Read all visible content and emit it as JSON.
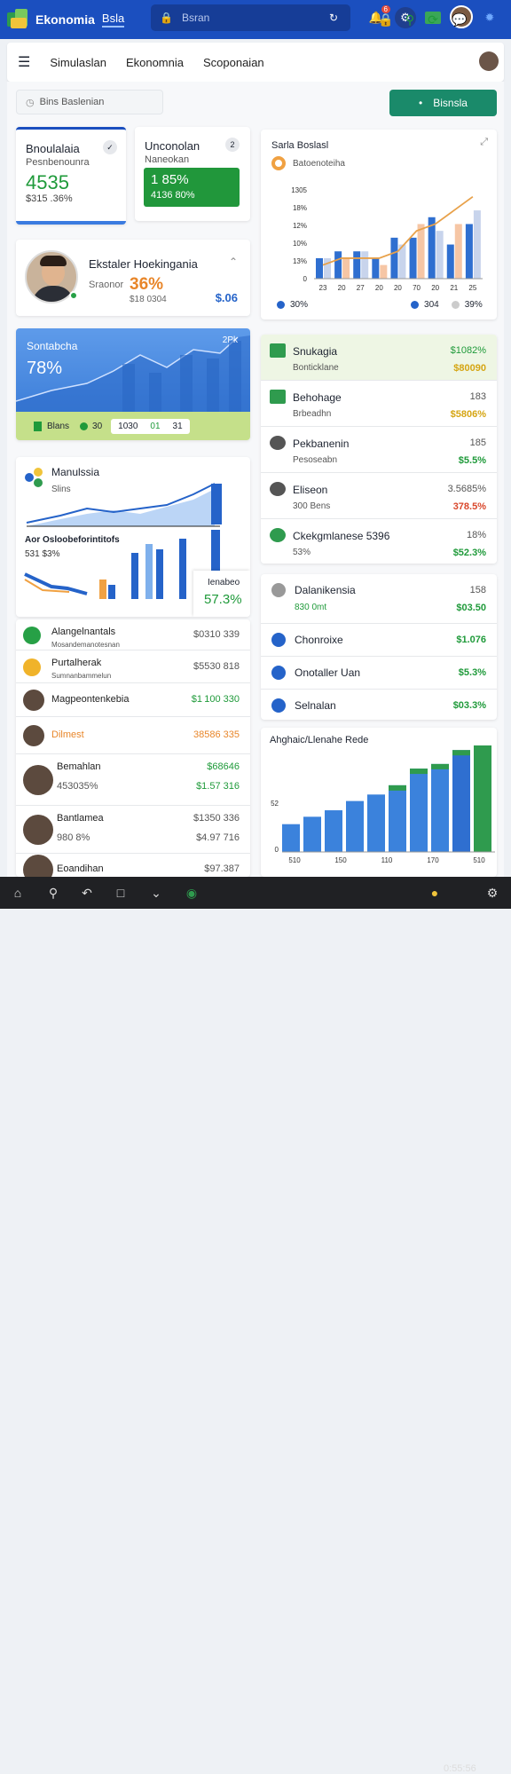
{
  "app": {
    "title": "Ekonomia",
    "tab": "Bsla",
    "search_placeholder": "Bsran",
    "notif_count": "6"
  },
  "nav": {
    "links": [
      "Simulaslan",
      "Ekonomnia",
      "Scoponaian"
    ]
  },
  "toolbar": {
    "filter_placeholder": "Bins Baslenian",
    "cta_label": "Bisnsla"
  },
  "stat1": {
    "title": "Bnoulalaia",
    "subtitle": "Pesnbenounra",
    "value": "4535",
    "sub_value": "$315 .36%"
  },
  "stat2": {
    "title": "Unconolan",
    "subtitle": "Naneokan",
    "value": "1 85%",
    "sub_value": "4136 80%",
    "badge": "2"
  },
  "profile": {
    "title": "Ekstaler Hoekingania",
    "label": "Sraonor",
    "pct": "36%",
    "sub": "$18 0304",
    "value": "$.06"
  },
  "summary": {
    "title": "Sontabcha",
    "value": "78%",
    "legend": [
      "Blans",
      "30",
      "1030",
      "01",
      "31",
      "2Pk"
    ]
  },
  "bar_panel": {
    "title": "Sarla Boslasl",
    "subtitle": "Batoenoteiha",
    "footer": [
      "30%",
      "304",
      "39%"
    ]
  },
  "chart_data": [
    {
      "type": "bar",
      "title": "Sarla Boslasl",
      "y_ticks": [
        "1305",
        "18%",
        "12%",
        "10%",
        "13%",
        "0"
      ],
      "x_ticks": [
        "23",
        "20",
        "27",
        "20",
        "20",
        "70",
        "20",
        "21",
        "25"
      ],
      "series": [
        {
          "values": [
            3,
            4,
            4,
            3,
            6,
            6,
            9,
            5,
            8
          ]
        },
        {
          "values": [
            3,
            3,
            4,
            2,
            5,
            8,
            7,
            8,
            10
          ]
        }
      ],
      "line": [
        2,
        3,
        3,
        3,
        4,
        7,
        8,
        10,
        12
      ]
    },
    {
      "type": "bar",
      "title": "Ahghaic/Llenahe Rede",
      "x_ticks": [
        "510",
        "150",
        "110",
        "170",
        "510"
      ],
      "y_ticks": [
        "52",
        "0"
      ],
      "values": [
        30,
        38,
        45,
        55,
        62,
        72,
        90,
        95,
        110,
        115
      ]
    }
  ],
  "list_right": [
    {
      "title": "Snukagia",
      "sub": "Bonticklane",
      "v1": "$1082%",
      "v2": "$80090"
    },
    {
      "title": "Behohage",
      "sub": "Brbeadhn",
      "v1": "183",
      "v2": "$5806%"
    },
    {
      "title": "Pekbanenin",
      "sub": "Pesoseabn",
      "v1": "185",
      "v2": "$5.5%"
    },
    {
      "title": "Eliseon",
      "sub": "300 Bens",
      "v1": "3.5685%",
      "v2": "378.5%"
    },
    {
      "title": "Ckekgmlanese 5396",
      "sub": "53%",
      "v1": "18%",
      "v2": "$52.3%"
    }
  ],
  "list_right2": [
    {
      "title": "Dalanikensia",
      "sub": "830 0mt",
      "v1": "158",
      "v2": "$03.50"
    },
    {
      "title": "Chonroixe",
      "v2": "$1.076"
    },
    {
      "title": "Onotaller Uan",
      "v2": "$5.3%"
    },
    {
      "title": "Selnalan",
      "v2": "$03.3%"
    }
  ],
  "mini_panel": {
    "title": "Manulssia",
    "sub": "Slins",
    "mid": "Aor Osloobeforintitofs",
    "mid_sub": "531 $3%",
    "card_title": "Ienabeo",
    "card_value": "57.3%"
  },
  "list_left": [
    {
      "title": "Alangelnantals",
      "sub": "Mosandemanotesnan",
      "value": "$0310 339"
    },
    {
      "title": "Purtalherak",
      "sub": "Sumnanbammelun",
      "value": "$5530 818"
    },
    {
      "title": "Magpeontenkebia",
      "value": "$1 100 330"
    },
    {
      "title": "Dilmest",
      "value": "38586 335"
    },
    {
      "title": "Bemahlan",
      "sub": "453035%",
      "value": "$68646",
      "value2": "$1.57 316"
    },
    {
      "title": "Bantlamea",
      "sub": "980 8%",
      "value": "$1350 336",
      "value2": "$4.97 716"
    },
    {
      "title": "Eoandihan",
      "value": "$97.387"
    }
  ],
  "status": {
    "clock": "0:55:56"
  }
}
